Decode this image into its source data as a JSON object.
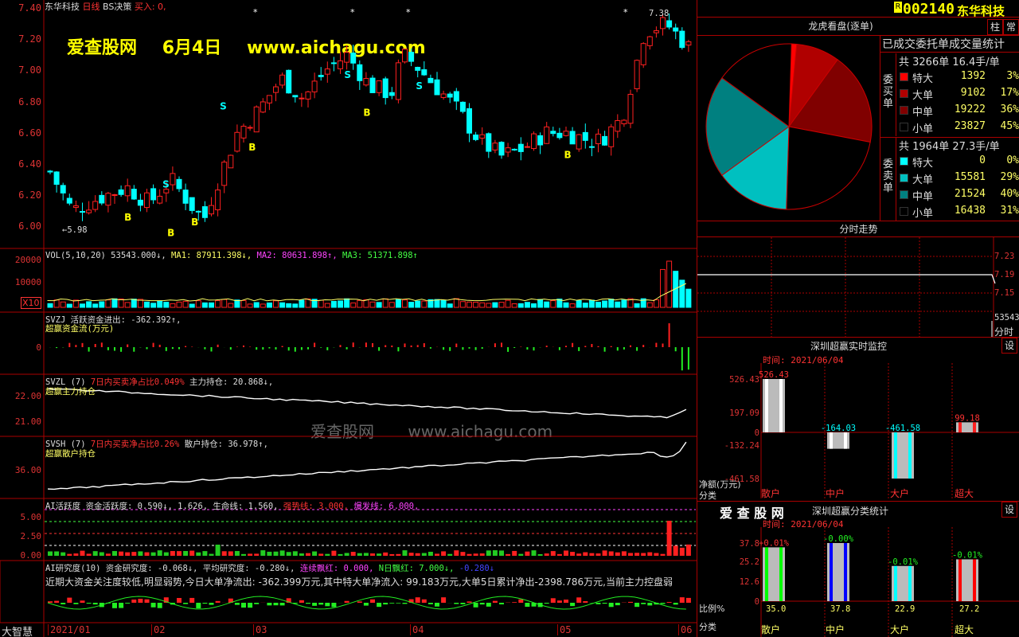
{
  "header": {
    "stock_name": "东华科技",
    "period": "日线",
    "strategy": "BS决策",
    "buy_in": "买入: 0,"
  },
  "watermark": {
    "site": "爱查股网",
    "date": "6月4日",
    "url": "www.aichagu.com",
    "mid_text": "爱查股网",
    "mid_url": "www.aichagu.com"
  },
  "price_axis": [
    "7.40",
    "7.20",
    "7.00",
    "6.80",
    "6.60",
    "6.40",
    "6.20",
    "6.00"
  ],
  "price_annotations": {
    "low": "5.98",
    "high": "7.38"
  },
  "vol": {
    "label": "VOL(5,10,20) 53543.000↓,",
    "ma1": "MA1: 87911.398↓,",
    "ma2": "MA2: 80631.898↑,",
    "ma3": "MA3: 51371.898↑",
    "axis": [
      "20000",
      "10000"
    ],
    "unit": "X10"
  },
  "svzj": {
    "label": "SVZJ  活跃资金进出: -362.392↑,",
    "sub": "超赢资金流(万元)",
    "axis": [
      "0"
    ]
  },
  "svzl": {
    "label": "SVZL (7)",
    "part1": "7日内买卖净占比0.049%",
    "part2": "主力持仓: 20.868↓,",
    "sub": "超赢主力持仓",
    "axis": [
      "22.00",
      "21.00"
    ]
  },
  "svsh": {
    "label": "SVSH (7)",
    "part1": "7日内买卖净占比0.26%",
    "part2": "散户持仓: 36.978↑,",
    "sub": "超赢散户持仓",
    "axis": [
      "36.00"
    ]
  },
  "ai": {
    "label": "AI活跃度  资金活跃度: 0.590↓, 1.626, 生命线: 1.560,",
    "strong": "强势线: 3.000,",
    "burst": "爆发线: 6.000,",
    "axis": [
      "5.00",
      "2.50",
      "0.00"
    ]
  },
  "research": {
    "label": "AI研究度(10) 资金研究度: -0.068↓, 平均研究度: -0.280↓,",
    "red_line": "连续飘红: 0.000,",
    "green_line": "N日飘红: 7.000↓,",
    "blue_val": "-0.280↓",
    "commentary": "近期大资金关注度较低,明显弱势,今日大单净流出: -362.399万元,其中特大单净流入: 99.183万元,大单5日累计净出-2398.786万元,当前主力控盘弱"
  },
  "x_axis": [
    "2021/01",
    "02",
    "03",
    "04",
    "05",
    "06"
  ],
  "bottom_left": "大智慧",
  "right_header": {
    "code": "002140",
    "name": "东华科技",
    "btn1": "柱",
    "btn2": "常"
  },
  "longhu": {
    "title": "龙虎看盘(逐单)",
    "subtitle": "已成交委托单成交量统计",
    "buy_label": "委买单",
    "sell_label": "委卖单",
    "buy_total": "共 3266单 16.4手/单",
    "sell_total": "共 1964单 27.3手/单",
    "buy_rows": [
      {
        "name": "特大",
        "count": "1392",
        "pct": "3%",
        "color": "#ff0000"
      },
      {
        "name": "大单",
        "count": "9102",
        "pct": "17%",
        "color": "#b00000"
      },
      {
        "name": "中单",
        "count": "19222",
        "pct": "36%",
        "color": "#800000"
      },
      {
        "name": "小单",
        "count": "23827",
        "pct": "45%",
        "color": "#000000"
      }
    ],
    "sell_rows": [
      {
        "name": "特大",
        "count": "0",
        "pct": "0%",
        "color": "#00ffff"
      },
      {
        "name": "大单",
        "count": "15581",
        "pct": "29%",
        "color": "#00c0c0"
      },
      {
        "name": "中单",
        "count": "21524",
        "pct": "40%",
        "color": "#008080"
      },
      {
        "name": "小单",
        "count": "16438",
        "pct": "31%",
        "color": "#000000"
      }
    ]
  },
  "timeline": {
    "title": "分时走势",
    "axis": [
      "7.23",
      "7.19",
      "7.15"
    ],
    "vol": "53543",
    "vol_label": "分时"
  },
  "monitor": {
    "title": "深圳超赢实时监控",
    "set_btn": "设",
    "time": "时间: 2021/06/04",
    "axis": [
      "526.43",
      "197.09",
      "0",
      "-132.24",
      "-461.58"
    ],
    "bars": [
      {
        "cat": "散户",
        "value": 526.43,
        "label": "526.43"
      },
      {
        "cat": "中户",
        "value": -164.03,
        "label": "-164.03"
      },
      {
        "cat": "大户",
        "value": -461.58,
        "label": "-461.58"
      },
      {
        "cat": "超大",
        "value": 99.18,
        "label": "99.18"
      }
    ],
    "y_title": "净额(万元)",
    "x_title": "分类"
  },
  "classify": {
    "brand": "爱 查 股 网",
    "title": "深圳超赢分类统计",
    "set_btn": "设",
    "time": "时间: 2021/06/04",
    "axis": [
      "37.8",
      "25.2",
      "12.6",
      "0"
    ],
    "bars": [
      {
        "cat": "散户",
        "value": 35.0,
        "label": "35.0",
        "top": "+0.01%",
        "color": "#00ff00"
      },
      {
        "cat": "中户",
        "value": 37.8,
        "label": "37.8",
        "top": "-0.00%",
        "color": "#0000ff"
      },
      {
        "cat": "大户",
        "value": 22.9,
        "label": "22.9",
        "top": "-0.01%",
        "color": "#00ffff"
      },
      {
        "cat": "超大",
        "value": 27.2,
        "label": "27.2",
        "top": "-0.01%",
        "color": "#ff0000"
      }
    ],
    "y_title": "比例%",
    "x_title": "分类"
  },
  "chart_data": {
    "type": "bar",
    "title": "深圳超赢实时监控",
    "categories": [
      "散户",
      "中户",
      "大户",
      "超大"
    ],
    "values": [
      526.43,
      -164.03,
      -461.58,
      99.18
    ],
    "ylabel": "净额(万元)",
    "xlabel": "分类",
    "ylim": [
      -461.58,
      526.43
    ]
  }
}
